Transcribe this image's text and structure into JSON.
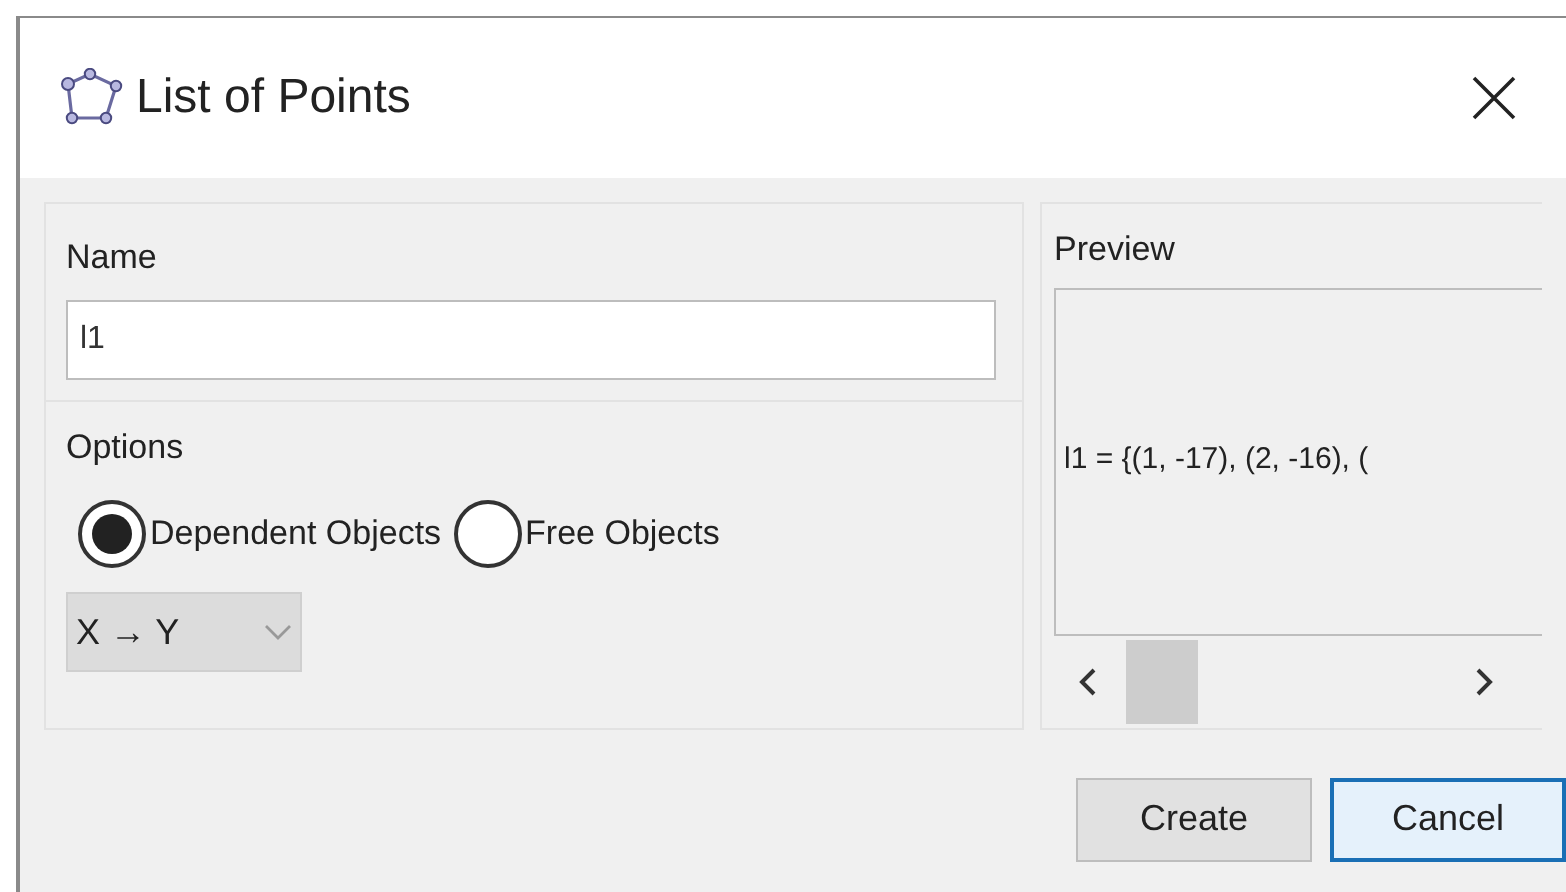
{
  "window": {
    "title": "List of Points"
  },
  "name_section": {
    "label": "Name",
    "value": "l1"
  },
  "options_section": {
    "label": "Options",
    "radios": [
      {
        "label": "Dependent Objects",
        "selected": true
      },
      {
        "label": "Free Objects",
        "selected": false
      }
    ],
    "dropdown": {
      "value": "X → Y"
    }
  },
  "preview_section": {
    "label": "Preview",
    "text": "l1 = {(1, -17), (2, -16), ("
  },
  "buttons": [
    {
      "label": "Create",
      "focused": false
    },
    {
      "label": "Cancel",
      "focused": true
    }
  ]
}
